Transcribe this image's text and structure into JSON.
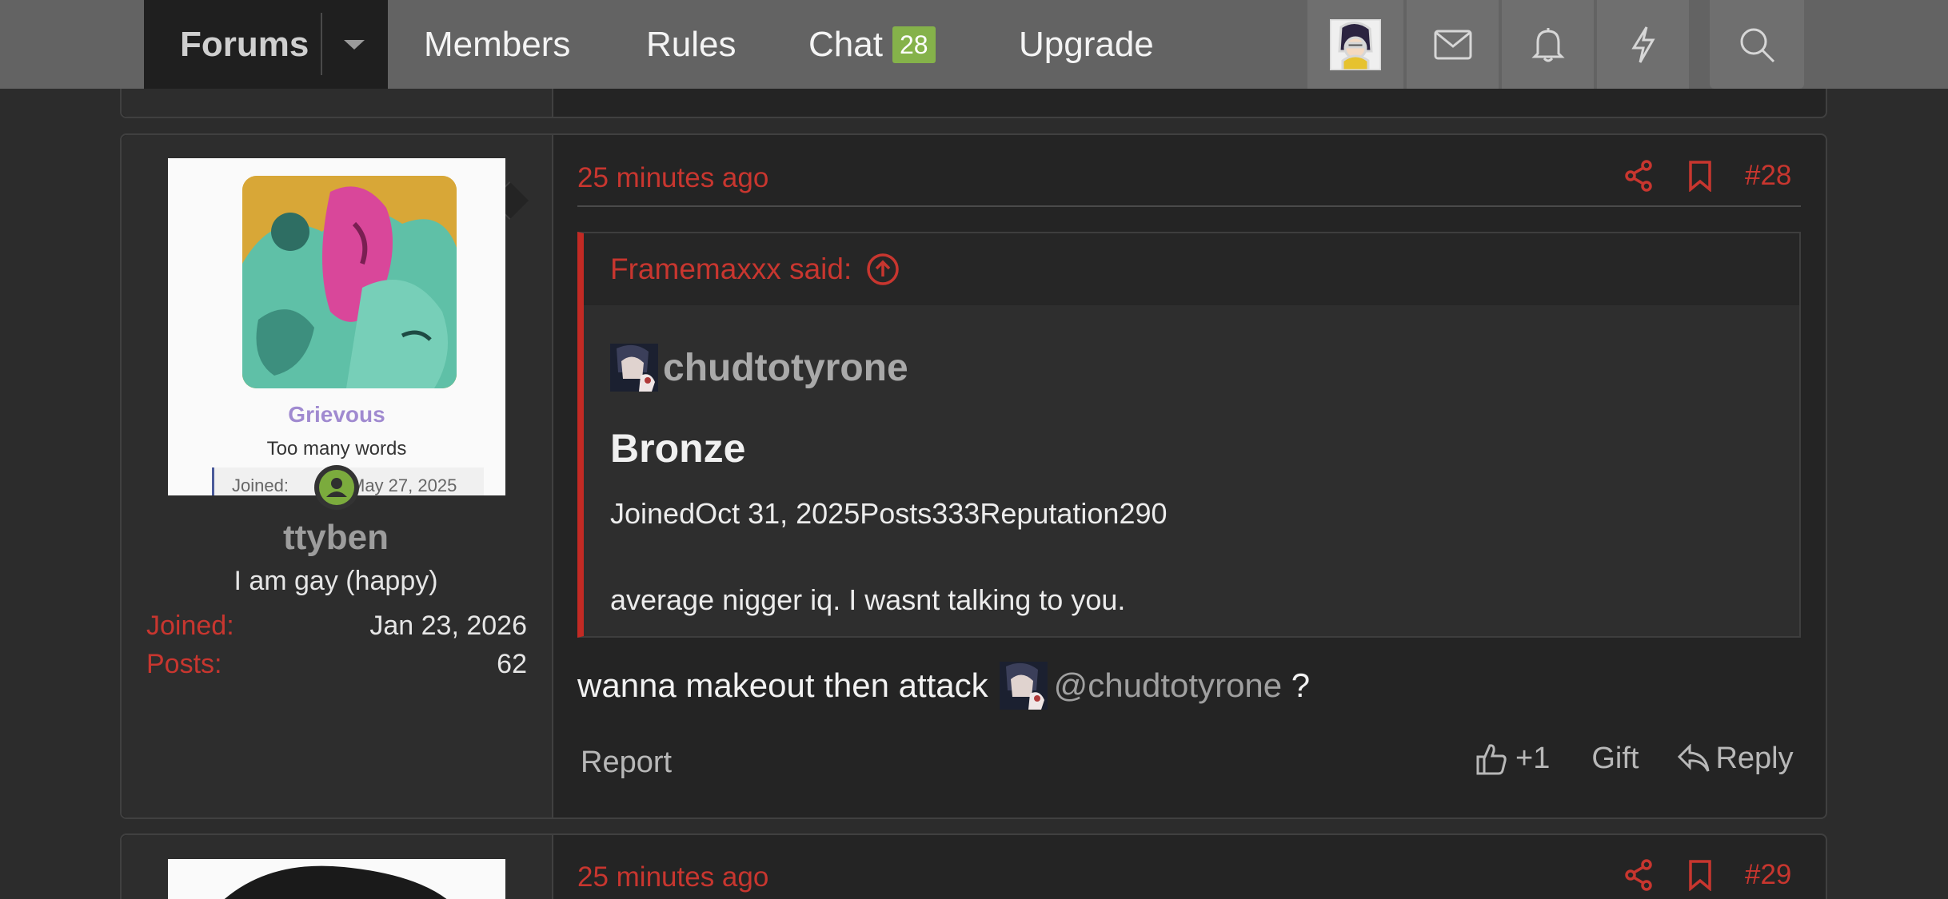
{
  "nav": {
    "forums_label": "Forums",
    "members_label": "Members",
    "rules_label": "Rules",
    "chat_label": "Chat",
    "chat_count": "28",
    "upgrade_label": "Upgrade",
    "icons": [
      "avatar",
      "mail-icon",
      "bell-icon",
      "lightning-icon",
      "search-icon"
    ]
  },
  "post28": {
    "time": "25 minutes ago",
    "number": "#28",
    "author": {
      "card_name": "Grievous",
      "card_title": "Too many words",
      "card_joined_label": "Joined:",
      "card_joined_value": "May 27, 2025",
      "username": "ttyben",
      "user_title": "I am gay (happy)",
      "joined_label": "Joined:",
      "joined_value": "Jan 23, 2026",
      "posts_label": "Posts:",
      "posts_value": "62"
    },
    "quote": {
      "header": "Framemaxxx said:",
      "username": "chudtotyrone",
      "rank": "Bronze",
      "stats": "JoinedOct 31, 2025Posts333Reputation290",
      "message": "average nigger iq. I wasnt talking to you."
    },
    "message_before": "wanna makeout then attack",
    "mention": "@chudtotyrone",
    "message_after": " ?",
    "report_label": "Report",
    "reaction_count": "+1",
    "gift_label": "Gift",
    "reply_label": "Reply"
  },
  "post29": {
    "time": "25 minutes ago",
    "number": "#29"
  },
  "colors": {
    "accent_red": "#c8362f",
    "badge_green": "#85b24a",
    "nav_bg": "#636363"
  }
}
